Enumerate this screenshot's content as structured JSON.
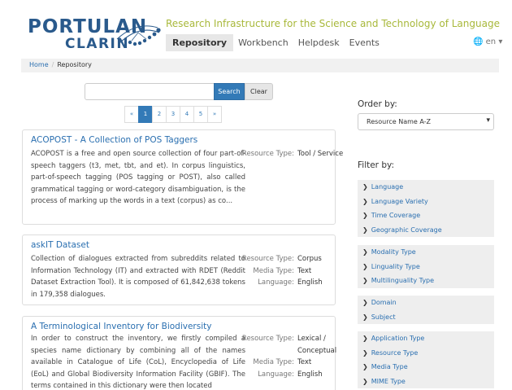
{
  "header": {
    "logo_top": "PORTULAN",
    "logo_bottom": "CLARIN",
    "tagline": "Research Infrastructure for the Science and Technology of Language",
    "nav": [
      "Repository",
      "Workbench",
      "Helpdesk",
      "Events"
    ],
    "lang": "en"
  },
  "breadcrumb": {
    "home": "Home",
    "current": "Repository"
  },
  "search": {
    "value": "",
    "placeholder": "",
    "search_label": "Search",
    "clear_label": "Clear"
  },
  "pagination": {
    "prev": "«",
    "pages": [
      "1",
      "2",
      "3",
      "4",
      "5"
    ],
    "next": "»",
    "active": "1"
  },
  "results": [
    {
      "title": "ACOPOST - A Collection of POS Taggers",
      "desc": "ACOPOST is a free and open source collection of four part-of-speech taggers (t3, met, tbt, and et). In corpus linguistics, part-of-speech tagging (POS tagging or POST), also called grammatical tagging or word-category disambiguation, is the process of marking up the words in a text (corpus) as co...",
      "meta": [
        {
          "label": "Resource Type:",
          "value": "Tool / Service"
        }
      ]
    },
    {
      "title": "askIT Dataset",
      "desc": "Collection of dialogues extracted from subreddits related to Information Technology (IT) and extracted with RDET (Reddit Dataset Extraction Tool). It is composed of 61,842,638 tokens in 179,358 dialogues.",
      "meta": [
        {
          "label": "Resource Type:",
          "value": "Corpus"
        },
        {
          "label": "Media Type:",
          "value": "Text"
        },
        {
          "label": "Language:",
          "value": "English"
        }
      ]
    },
    {
      "title": "A Terminological Inventory for Biodiversity",
      "desc": "In order to construct the inventory, we firstly compiled a species name dictionary by combining all of the names available in Catalogue of Life (CoL), Encyclopedia of Life (EoL) and Global Biodiversity Information Facility (GBIF). The terms contained in this dictionary were then located",
      "meta": [
        {
          "label": "Resource Type:",
          "value": "Lexical /"
        },
        {
          "label": "",
          "value": "Conceptual"
        },
        {
          "label": "Media Type:",
          "value": "Text"
        },
        {
          "label": "Language:",
          "value": "English"
        }
      ]
    }
  ],
  "order": {
    "label": "Order by:",
    "value": "Resource Name A-Z"
  },
  "filter": {
    "label": "Filter by:",
    "groups": [
      [
        "Language",
        "Language Variety",
        "Time Coverage",
        "Geographic Coverage"
      ],
      [
        "Modality Type",
        "Linguality Type",
        "Multilinguality Type"
      ],
      [
        "Domain",
        "Subject"
      ],
      [
        "Application Type",
        "Resource Type",
        "Media Type",
        "MIME Type"
      ]
    ]
  },
  "colors": {
    "brand_blue": "#2a5a8c",
    "tagline_green": "#a8b83a",
    "link_blue": "#2a6fb0",
    "primary_button": "#337ab7"
  }
}
